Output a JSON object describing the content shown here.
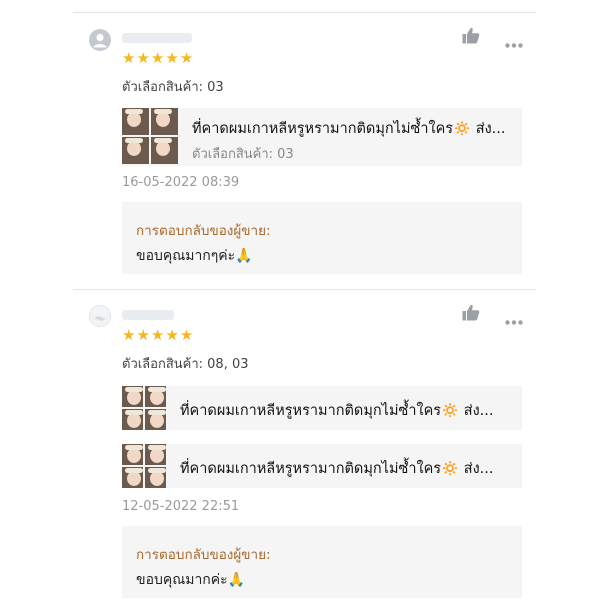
{
  "reviews": [
    {
      "rating": 5,
      "rating_stars": "★★★★★",
      "option_text": "ตัวเลือกสินค้า: 03",
      "products": [
        {
          "title": "ที่คาดผมเกาหลีหรูหรามากติดมุกไม่ซ้ำใคร🔅 ส่ง...",
          "variant": "ตัวเลือกสินค้า: 03"
        }
      ],
      "timestamp": "16-05-2022 08:39",
      "seller_reply": {
        "label": "การตอบกลับของผู้ขาย:",
        "text": "ขอบคุณมากๆค่ะ🙏"
      }
    },
    {
      "rating": 5,
      "rating_stars": "★★★★★",
      "option_text": "ตัวเลือกสินค้า: 08, 03",
      "products": [
        {
          "title": "ที่คาดผมเกาหลีหรูหรามากติดมุกไม่ซ้ำใคร🔅 ส่ง..."
        },
        {
          "title": "ที่คาดผมเกาหลีหรูหรามากติดมุกไม่ซ้ำใคร🔅 ส่ง..."
        }
      ],
      "timestamp": "12-05-2022 22:51",
      "seller_reply": {
        "label": "การตอบกลับของผู้ขาย:",
        "text": "ขอบคุณมากค่ะ🙏"
      }
    }
  ],
  "icons": {
    "like": "thumbs-up-icon",
    "more": "more-options-icon",
    "avatar": "user-avatar-icon"
  },
  "colors": {
    "star": "#f4b81f",
    "reply_label": "#a86a2e",
    "card_bg": "#f5f5f5",
    "icon_gray": "#9aa0a6"
  }
}
